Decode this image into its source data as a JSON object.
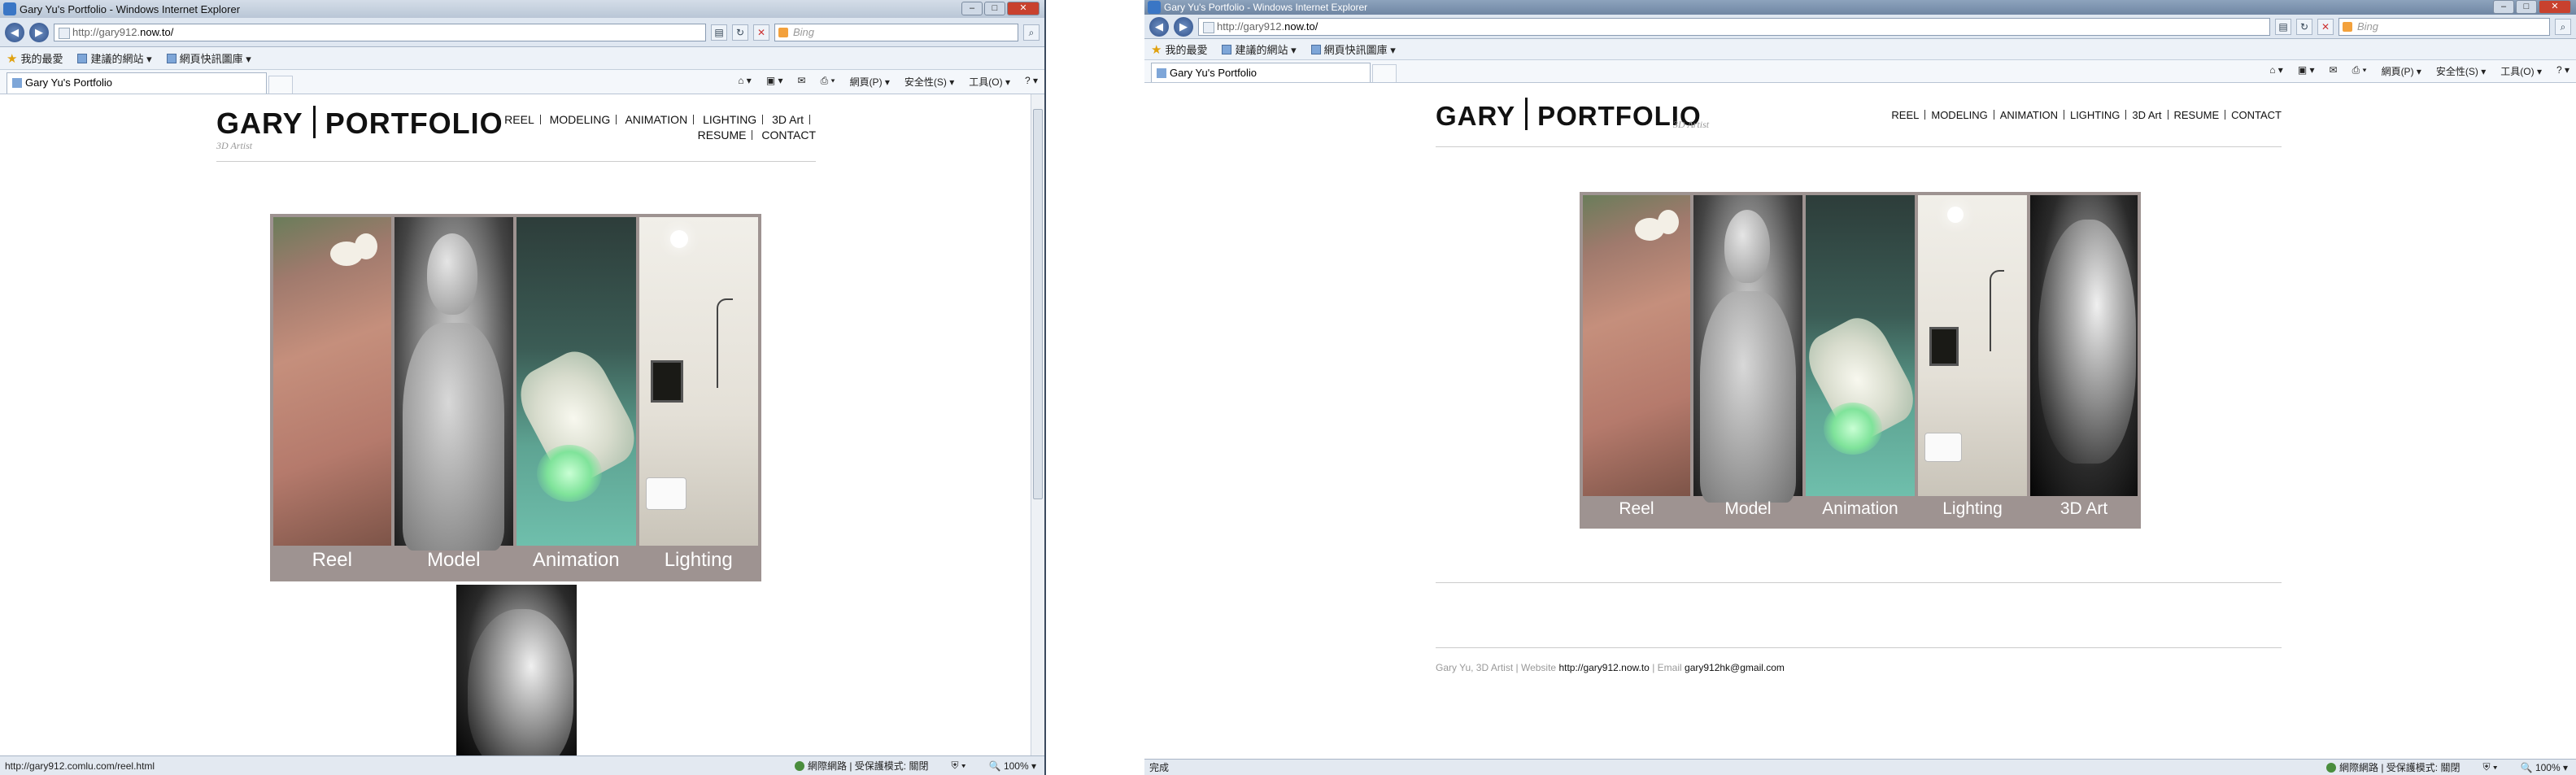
{
  "window1": {
    "title": "Gary Yu's Portfolio - Windows Internet Explorer",
    "address": {
      "prefix": "http://gary912.",
      "domain": "now.to/"
    },
    "search_placeholder": "Bing",
    "favorites": {
      "star_label": "我的最愛",
      "suggested": "建議的網站 ▾",
      "gallery": "網頁快訊圖庫 ▾"
    },
    "tab": "Gary Yu's Portfolio",
    "commands": {
      "page": "網頁(P) ▾",
      "safety": "安全性(S) ▾",
      "tools": "工具(O) ▾",
      "help": "? ▾"
    },
    "status": {
      "left": "http://gary912.comlu.com/reel.html",
      "zone": "網際網路 | 受保護模式: 關閉",
      "zoom": "100%"
    }
  },
  "window2": {
    "title": "Gary Yu's Portfolio - Windows Internet Explorer",
    "address": {
      "prefix": "http://gary912.",
      "domain": "now.to/"
    },
    "search_placeholder": "Bing",
    "favorites": {
      "star_label": "我的最愛",
      "suggested": "建議的網站 ▾",
      "gallery": "網頁快訊圖庫 ▾"
    },
    "tab": "Gary Yu's Portfolio",
    "commands": {
      "page": "網頁(P) ▾",
      "safety": "安全性(S) ▾",
      "tools": "工具(O) ▾",
      "help": "? ▾"
    },
    "status": {
      "left": "完成",
      "zone": "網際網路 | 受保護模式: 關閉",
      "zoom": "100%"
    }
  },
  "site": {
    "title_left": "GARY",
    "title_right": "PORTFOLIO",
    "subtitle": "3D Artist",
    "nav": [
      "REEL",
      "MODELING",
      "ANIMATION",
      "LIGHTING",
      "3D Art",
      "RESUME",
      "CONTACT"
    ],
    "panels": [
      "Reel",
      "Model",
      "Animation",
      "Lighting",
      "3D Art"
    ],
    "footer": {
      "name": "Gary Yu, 3D Artist",
      "website_label": "Website",
      "website": "http://gary912.now.to",
      "email_label": "Email",
      "email": "gary912hk@gmail.com"
    }
  }
}
